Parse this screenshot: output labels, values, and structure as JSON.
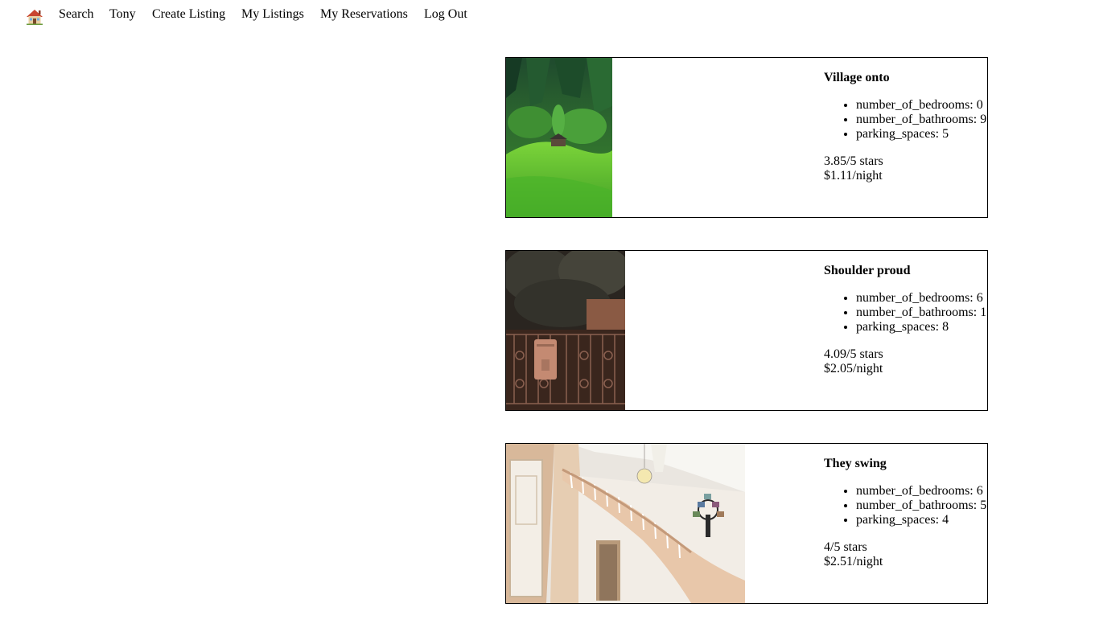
{
  "nav": {
    "home_icon": "house-emoji-icon",
    "search": "Search",
    "user": "Tony",
    "create_listing": "Create Listing",
    "my_listings": "My Listings",
    "my_reservations": "My Reservations",
    "log_out": "Log Out"
  },
  "listings": [
    {
      "title": "Village onto",
      "image": "forest-hillside-cabin-photo",
      "amenities": [
        "number_of_bedrooms: 0",
        "number_of_bathrooms: 9",
        "parking_spaces: 5"
      ],
      "rating": "3.85/5 stars",
      "price": "$1.11/night"
    },
    {
      "title": "Shoulder proud",
      "image": "iron-gate-mailbox-photo",
      "amenities": [
        "number_of_bedrooms: 6",
        "number_of_bathrooms: 1",
        "parking_spaces: 8"
      ],
      "rating": "4.09/5 stars",
      "price": "$2.05/night"
    },
    {
      "title": "They swing",
      "image": "staircase-foyer-photo",
      "amenities": [
        "number_of_bedrooms: 6",
        "number_of_bathrooms: 5",
        "parking_spaces: 4"
      ],
      "rating": "4/5 stars",
      "price": "$2.51/night"
    }
  ]
}
